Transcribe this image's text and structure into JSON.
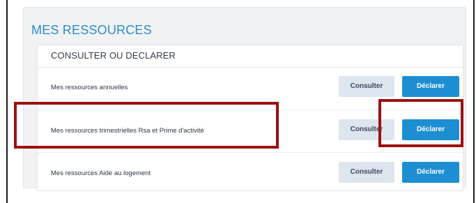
{
  "section": {
    "title": "MES RESSOURCES",
    "card_header": "CONSULTER OU DECLARER"
  },
  "rows": [
    {
      "label": "Mes ressources annuelles",
      "consult_label": "Consulter",
      "declare_label": "Déclarer"
    },
    {
      "label": "Mes ressources trimestrielles Rsa et Prime d'activité",
      "consult_label": "Consulter",
      "declare_label": "Déclarer"
    },
    {
      "label": "Mes ressources Aide au logement",
      "consult_label": "Consulter",
      "declare_label": "Déclarer"
    }
  ],
  "colors": {
    "title": "#2e8bc9",
    "declare_button": "#1e8ed2",
    "consult_button": "#dde6ef",
    "annotation_box": "#9b1111"
  }
}
